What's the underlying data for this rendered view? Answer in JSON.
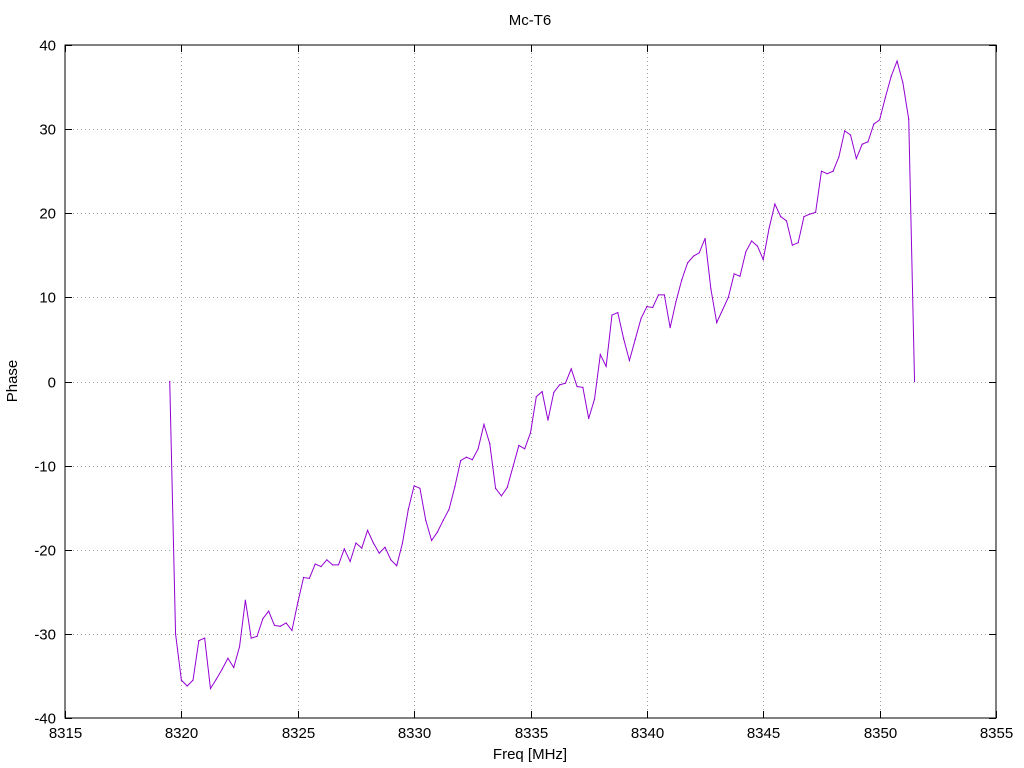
{
  "chart_data": {
    "type": "line",
    "title": "Mc-T6",
    "xlabel": "Freq [MHz]",
    "ylabel": "Phase",
    "xlim": [
      8315,
      8355
    ],
    "ylim": [
      -40,
      40
    ],
    "x_ticks": [
      8315,
      8320,
      8325,
      8330,
      8335,
      8340,
      8345,
      8350,
      8355
    ],
    "y_ticks": [
      -40,
      -30,
      -20,
      -10,
      0,
      10,
      20,
      30,
      40
    ],
    "grid": true,
    "line_color": "#9400d3",
    "series": [
      {
        "x": [
          8319.5,
          8319.75,
          8320.0,
          8320.25,
          8320.5,
          8320.75,
          8321.0,
          8321.25,
          8321.5,
          8321.75,
          8322.0,
          8322.25,
          8322.5,
          8322.75,
          8323.0,
          8323.25,
          8323.5,
          8323.75,
          8324.0,
          8324.25,
          8324.5,
          8324.75,
          8325.0,
          8325.25,
          8325.5,
          8325.75,
          8326.0,
          8326.25,
          8326.5,
          8326.75,
          8327.0,
          8327.25,
          8327.5,
          8327.75,
          8328.0,
          8328.25,
          8328.5,
          8328.75,
          8329.0,
          8329.25,
          8329.5,
          8329.75,
          8330.0,
          8330.25,
          8330.5,
          8330.75,
          8331.0,
          8331.25,
          8331.5,
          8331.75,
          8332.0,
          8332.25,
          8332.5,
          8332.75,
          8333.0,
          8333.25,
          8333.5,
          8333.75,
          8334.0,
          8334.25,
          8334.5,
          8334.75,
          8335.0,
          8335.25,
          8335.5,
          8335.75,
          8336.0,
          8336.25,
          8336.5,
          8336.75,
          8337.0,
          8337.25,
          8337.5,
          8337.75,
          8338.0,
          8338.25,
          8338.5,
          8338.75,
          8339.0,
          8339.25,
          8339.5,
          8339.75,
          8340.0,
          8340.25,
          8340.5,
          8340.75,
          8341.0,
          8341.25,
          8341.5,
          8341.75,
          8342.0,
          8342.25,
          8342.5,
          8342.75,
          8343.0,
          8343.25,
          8343.5,
          8343.75,
          8344.0,
          8344.25,
          8344.5,
          8344.75,
          8345.0,
          8345.25,
          8345.5,
          8345.75,
          8346.0,
          8346.25,
          8346.5,
          8346.75,
          8347.0,
          8347.25,
          8347.5,
          8347.75,
          8348.0,
          8348.25,
          8348.5,
          8348.75,
          8349.0,
          8349.25,
          8349.5,
          8349.75,
          8350.0,
          8350.25,
          8350.5,
          8350.75,
          8351.0,
          8351.25,
          8351.5
        ],
        "values": [
          0.0,
          -30.0,
          -35.5,
          -36.2,
          -35.5,
          -30.8,
          -30.5,
          -36.5,
          -35.4,
          -34.2,
          -32.9,
          -34.0,
          -31.5,
          -26.0,
          -30.5,
          -30.3,
          -28.2,
          -27.3,
          -29.0,
          -29.1,
          -28.7,
          -29.6,
          -26.3,
          -23.3,
          -23.4,
          -21.7,
          -22.0,
          -21.2,
          -21.8,
          -21.8,
          -19.9,
          -21.4,
          -19.2,
          -19.8,
          -17.7,
          -19.2,
          -20.4,
          -19.7,
          -21.2,
          -21.9,
          -19.2,
          -15.2,
          -12.4,
          -12.7,
          -16.5,
          -18.9,
          -17.9,
          -16.5,
          -15.2,
          -12.5,
          -9.4,
          -9.0,
          -9.3,
          -8.0,
          -5.1,
          -7.4,
          -12.7,
          -13.6,
          -12.6,
          -10.1,
          -7.6,
          -8.0,
          -6.1,
          -1.8,
          -1.2,
          -4.6,
          -1.3,
          -0.4,
          -0.2,
          1.5,
          -0.6,
          -0.7,
          -4.4,
          -2.1,
          3.2,
          1.8,
          7.9,
          8.2,
          5.1,
          2.5,
          5.0,
          7.5,
          8.9,
          8.8,
          10.3,
          10.3,
          6.4,
          9.5,
          12.1,
          14.1,
          14.9,
          15.3,
          17.0,
          11.0,
          7.0,
          8.5,
          10.0,
          12.8,
          12.5,
          15.4,
          16.7,
          16.1,
          14.5,
          18.2,
          21.1,
          19.6,
          19.1,
          16.2,
          16.5,
          19.6,
          19.9,
          20.1,
          25.0,
          24.7,
          25.0,
          26.7,
          29.8,
          29.3,
          26.5,
          28.2,
          28.5,
          30.6,
          31.1,
          33.8,
          36.3,
          38.1,
          35.5,
          31.2,
          0.0
        ]
      }
    ]
  }
}
